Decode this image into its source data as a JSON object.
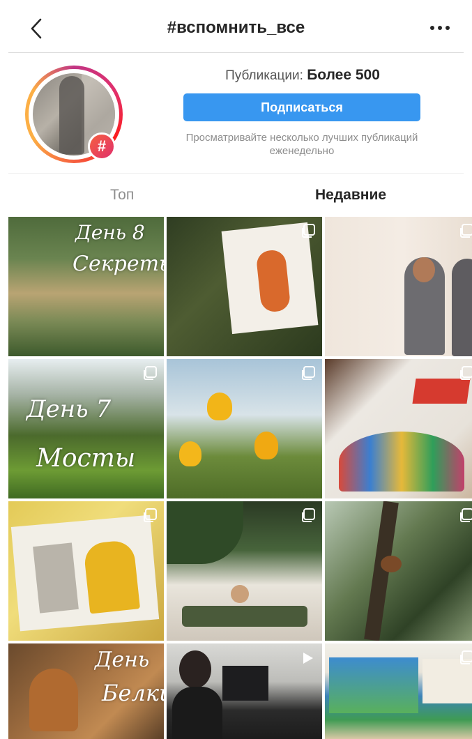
{
  "header": {
    "title": "#вспомнить_все",
    "back_icon": "chevron-left-icon",
    "more_icon": "more-horizontal-icon"
  },
  "profile": {
    "hashtag_badge": "#",
    "posts_label": "Публикации:",
    "posts_count": "Более 500",
    "follow_label": "Подписаться",
    "hint": "Просматривайте несколько лучших публикаций еженедельно",
    "accent_color": "#3897f0"
  },
  "tabs": [
    {
      "label": "Топ",
      "active": false
    },
    {
      "label": "Недавние",
      "active": true
    }
  ],
  "grid": {
    "posts": [
      {
        "overlay_line1": "День 8",
        "overlay_line2": "Секреты",
        "multi": false
      },
      {
        "overlay_line1": "",
        "overlay_line2": "",
        "multi": true
      },
      {
        "overlay_line1": "",
        "overlay_line2": "",
        "multi": true
      },
      {
        "overlay_line1": "День 7",
        "overlay_line2": "Мосты",
        "multi": true
      },
      {
        "overlay_line1": "",
        "overlay_line2": "",
        "multi": true
      },
      {
        "overlay_line1": "",
        "overlay_line2": "",
        "multi": true
      },
      {
        "overlay_line1": "",
        "overlay_line2": "",
        "multi": true
      },
      {
        "overlay_line1": "",
        "overlay_line2": "",
        "multi": true
      },
      {
        "overlay_line1": "",
        "overlay_line2": "",
        "multi": true
      },
      {
        "overlay_line1": "День",
        "overlay_line2": "Белки",
        "multi": false
      },
      {
        "overlay_line1": "",
        "overlay_line2": "",
        "video": true
      },
      {
        "overlay_line1": "",
        "overlay_line2": "",
        "multi": true
      }
    ]
  }
}
